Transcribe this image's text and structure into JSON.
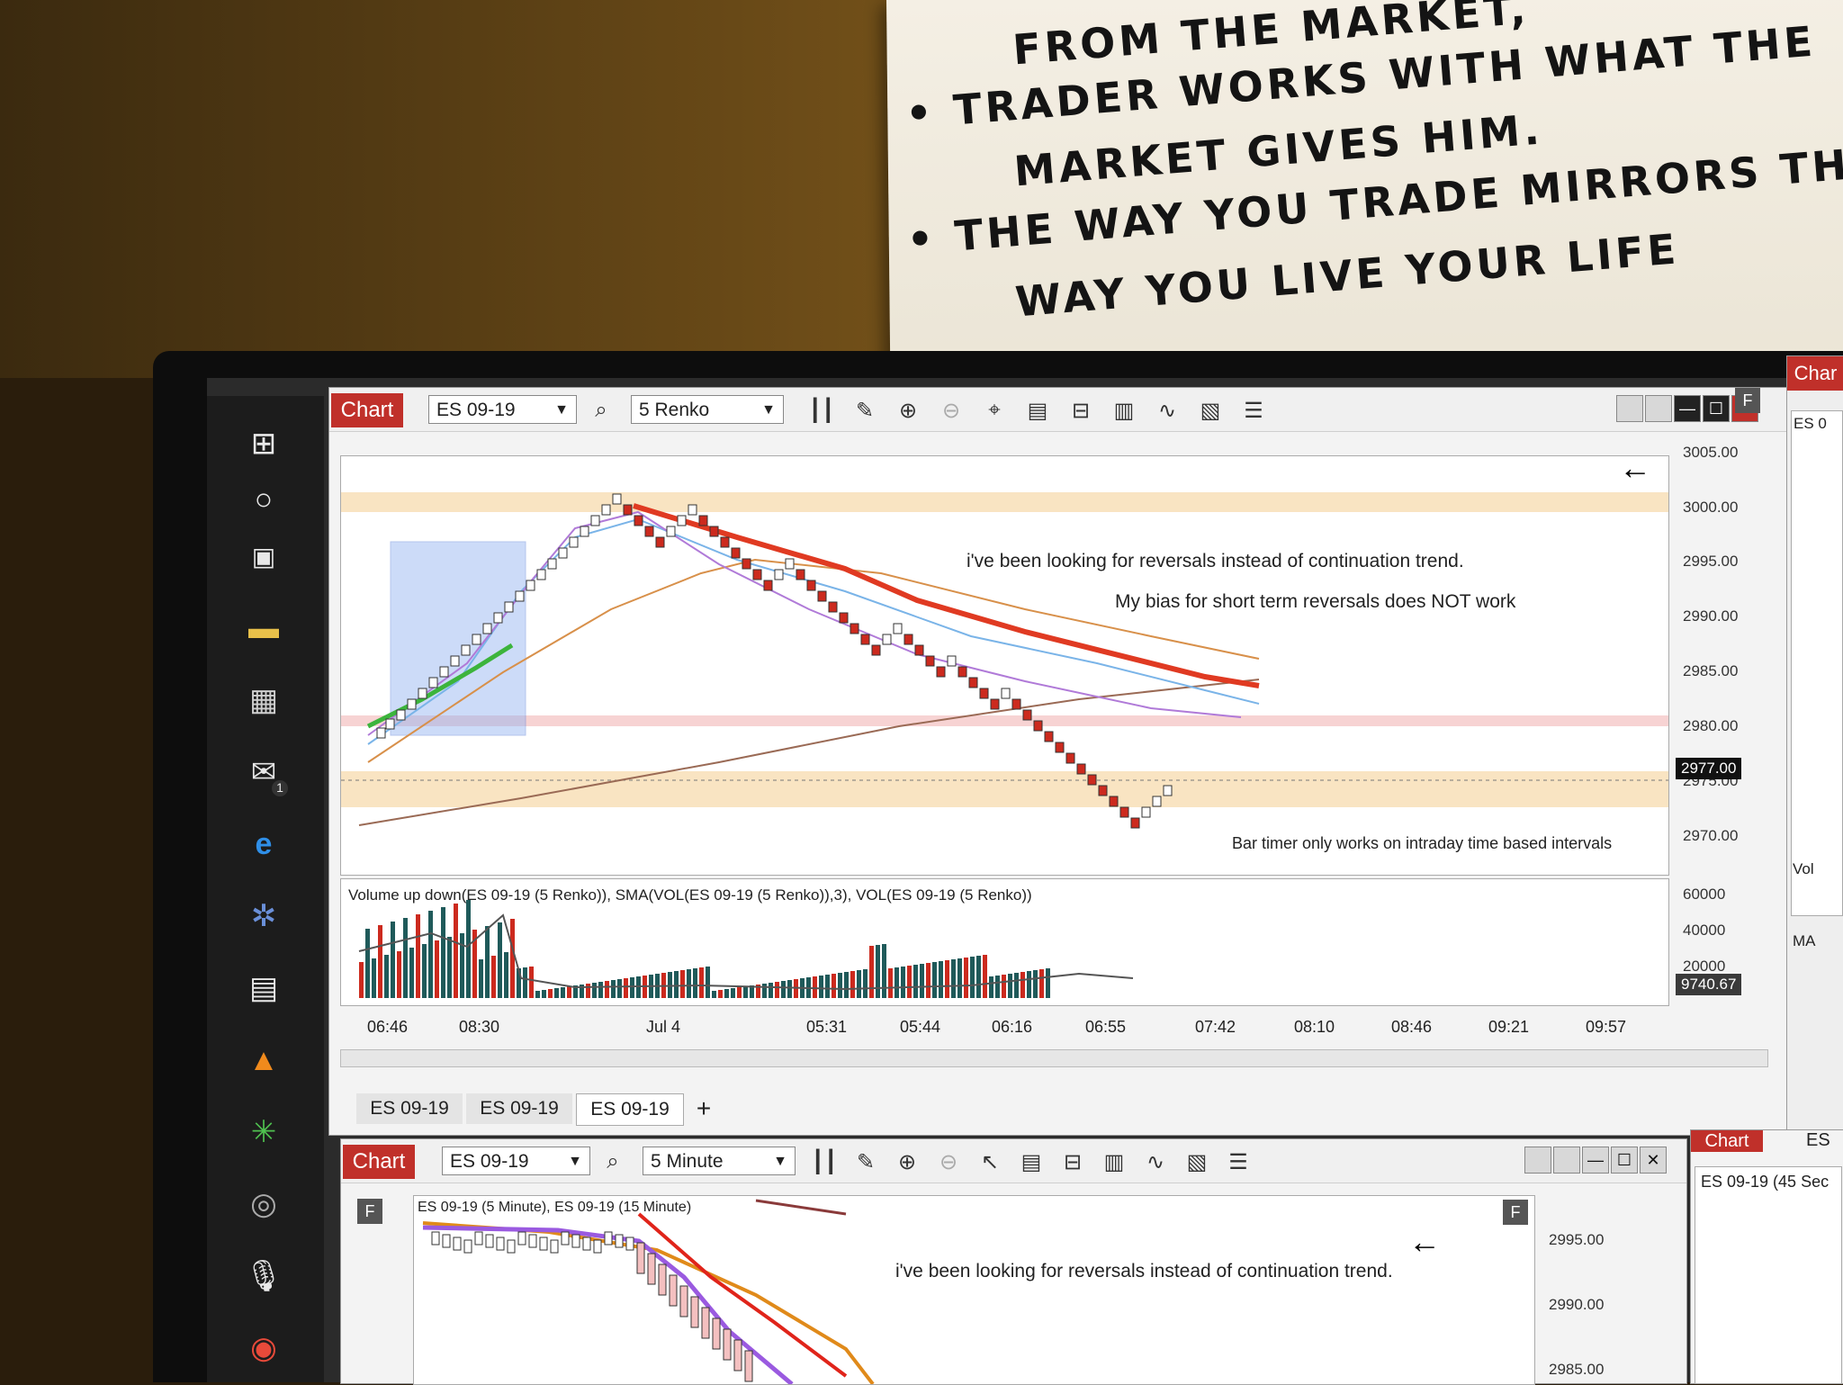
{
  "note": {
    "lines": [
      "FROM THE MARKET,",
      "• TRADER WORKS WITH WHAT THE",
      "MARKET GIVES HIM.",
      "• THE WAY YOU TRADE MIRRORS THE",
      "WAY YOU LIVE YOUR LIFE"
    ]
  },
  "taskbar": {
    "icons": [
      "windows-icon",
      "search-circle-icon",
      "task-view-icon",
      "file-explorer-icon",
      "store-icon",
      "mail-icon",
      "edge-icon",
      "ninjatrader-icon",
      "calculator-icon",
      "vlc-icon",
      "app-icon",
      "steam-icon",
      "microphone-icon",
      "chrome-icon"
    ],
    "mail_badge": "1"
  },
  "main_chart": {
    "tab_label": "Chart",
    "instrument": "ES 09-19",
    "interval": "5 Renko",
    "f_button": "F",
    "annotations": [
      "i've been looking for reversals instead of continuation trend.",
      "My bias for short term reversals does NOT work",
      "Bar timer only works on intraday time based intervals"
    ],
    "price_axis": [
      "3005.00",
      "3000.00",
      "2995.00",
      "2990.00",
      "2985.00",
      "2980.00",
      "2975.00",
      "2970.00"
    ],
    "current_price": "2977.00",
    "volume_title": "Volume up down(ES 09-19 (5 Renko)), SMA(VOL(ES 09-19 (5 Renko)),3), VOL(ES 09-19 (5 Renko))",
    "volume_axis": [
      "60000",
      "40000",
      "20000"
    ],
    "volume_value": "9740.67",
    "time_axis": [
      "06:46",
      "08:30",
      "Jul 4",
      "05:31",
      "05:44",
      "06:16",
      "06:55",
      "07:42",
      "08:10",
      "08:46",
      "09:21",
      "09:57"
    ],
    "tabs": [
      "ES 09-19",
      "ES 09-19",
      "ES 09-19"
    ],
    "add_tab": "+"
  },
  "bottom_chart": {
    "tab_label": "Chart",
    "instrument": "ES 09-19",
    "interval": "5 Minute",
    "f_button": "F",
    "legend": "ES 09-19 (5 Minute), ES 09-19 (15 Minute)",
    "annotation": "i've been looking for reversals instead of continuation trend.",
    "price_axis": [
      "2995.00",
      "2990.00",
      "2985.00"
    ]
  },
  "side_chart": {
    "tab_label": "Char",
    "instrument": "ES 0",
    "vol_label": "Vol",
    "ma_label": "MA"
  },
  "side_bottom": {
    "tab_label": "Chart",
    "instrument": "ES",
    "title": "ES 09-19 (45 Sec"
  }
}
